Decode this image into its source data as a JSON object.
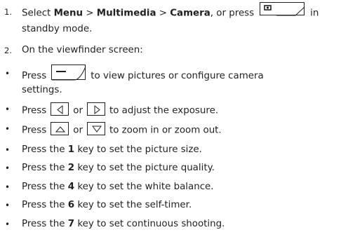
{
  "steps": [
    {
      "num": "1.",
      "pre": "Select",
      "menu": "Menu",
      "sep1": " > ",
      "multimedia": "Multimedia",
      "sep2": " > ",
      "camera": "Camera",
      "mid": ", or press",
      "post": "in",
      "cont": "standby mode."
    },
    {
      "num": "2.",
      "text": "On the viewfinder screen:"
    }
  ],
  "bullets": {
    "symbol": "•",
    "b1": {
      "pre": "Press",
      "post": "to view pictures or configure camera",
      "cont": "settings."
    },
    "b2": {
      "pre": "Press",
      "mid": "or",
      "post": "to adjust the exposure."
    },
    "b3": {
      "pre": "Press",
      "mid": "or",
      "post": "to zoom in or zoom out."
    },
    "keys": [
      {
        "pre": "Press the ",
        "key": "1",
        "post": " key to set the picture size."
      },
      {
        "pre": "Press the ",
        "key": "2",
        "post": " key to set the picture quality."
      },
      {
        "pre": "Press the ",
        "key": "4",
        "post": " key to set the white balance."
      },
      {
        "pre": "Press the ",
        "key": "6",
        "post": " key to set the self-timer."
      },
      {
        "pre": "Press the ",
        "key": "7",
        "post": " key to set continuous shooting."
      }
    ]
  },
  "icons": {
    "camera_key": "camera-key-icon",
    "soft_key": "left-soft-key-icon",
    "left": "left-arrow-key-icon",
    "right": "right-arrow-key-icon",
    "up": "up-arrow-key-icon",
    "down": "down-arrow-key-icon"
  }
}
